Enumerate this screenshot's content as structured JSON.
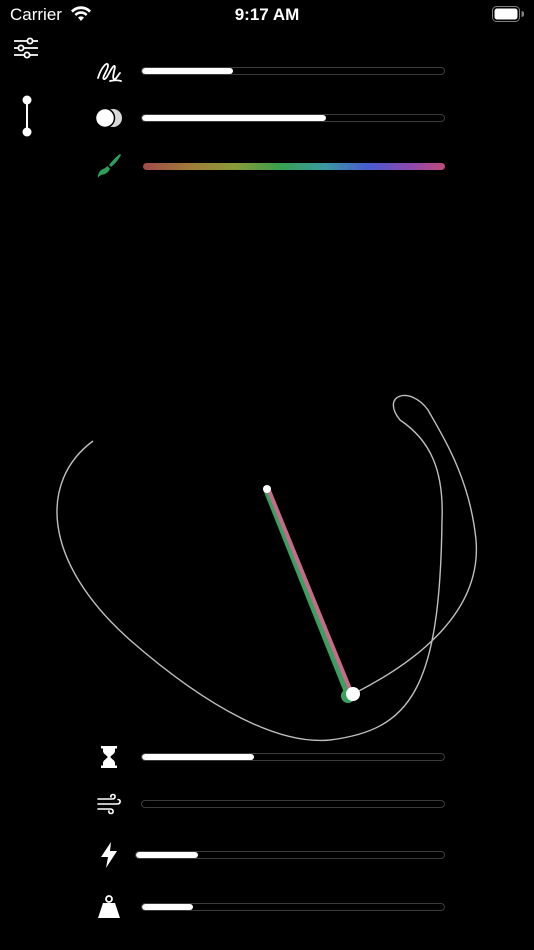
{
  "status_bar": {
    "carrier": "Carrier",
    "time": "9:17 AM"
  },
  "toolbar": {
    "settings_icon": "sliders-icon",
    "pendulum_mode_icon": "pendulum-icon"
  },
  "controls_top": [
    {
      "id": "stroke",
      "icon": "scribble-icon",
      "value": 0.3
    },
    {
      "id": "opacity",
      "icon": "circles-icon",
      "value": 0.61
    },
    {
      "id": "color",
      "icon": "paintbrush-icon",
      "accent": "#2e9e5a",
      "kind": "hue"
    }
  ],
  "controls_bottom": [
    {
      "id": "time",
      "icon": "hourglass-icon",
      "value": 0.37
    },
    {
      "id": "wind",
      "icon": "wind-icon",
      "value": 0.0
    },
    {
      "id": "energy",
      "icon": "lightning-icon",
      "value": 0.2
    },
    {
      "id": "weight",
      "icon": "weight-icon",
      "value": 0.17
    }
  ],
  "colors": {
    "background": "#000000",
    "track_border": "#3a3a3a",
    "fill": "#ffffff",
    "pendulum_rod_a": "#c86a8a",
    "pendulum_rod_b": "#3aa060",
    "trail": "#bfbfbf"
  }
}
